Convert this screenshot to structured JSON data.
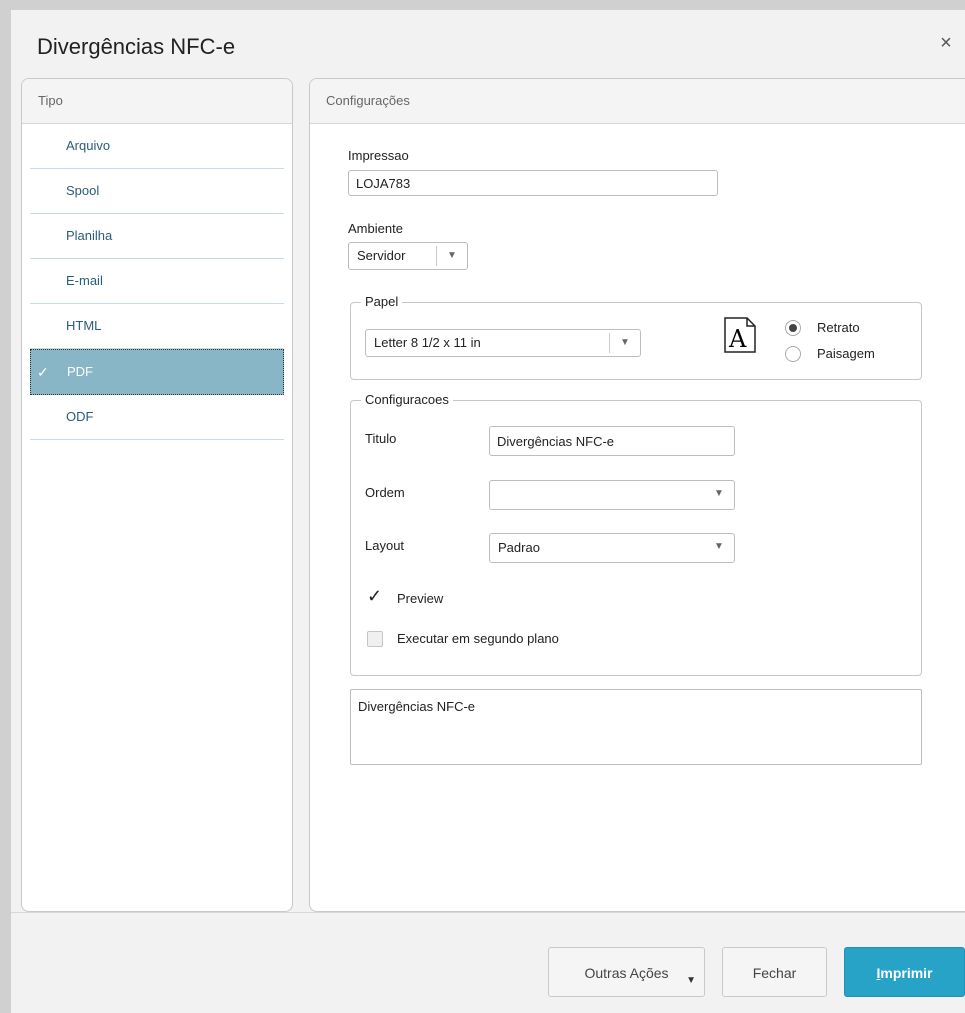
{
  "dialog": {
    "title": "Divergências NFC-e",
    "close_glyph": "×"
  },
  "tipo_panel": {
    "header": "Tipo",
    "items": [
      {
        "label": "Arquivo",
        "selected": false
      },
      {
        "label": "Spool",
        "selected": false
      },
      {
        "label": "Planilha",
        "selected": false
      },
      {
        "label": "E-mail",
        "selected": false
      },
      {
        "label": "HTML",
        "selected": false
      },
      {
        "label": "PDF",
        "selected": true
      },
      {
        "label": "ODF",
        "selected": false
      }
    ]
  },
  "config_panel": {
    "header": "Configurações",
    "impressao": {
      "label": "Impressao",
      "value": "LOJA783"
    },
    "ambiente": {
      "label": "Ambiente",
      "value": "Servidor"
    },
    "papel": {
      "legend": "Papel",
      "paper_size": "Letter 8 1/2 x 11 in",
      "icon_letter": "A",
      "orientation": {
        "retrato": "Retrato",
        "paisagem": "Paisagem",
        "selected": "Retrato"
      }
    },
    "configuracoes": {
      "legend": "Configuracoes",
      "titulo": {
        "label": "Titulo",
        "value": "Divergências NFC-e"
      },
      "ordem": {
        "label": "Ordem",
        "value": ""
      },
      "layout": {
        "label": "Layout",
        "value": "Padrao"
      },
      "preview": {
        "label": "Preview",
        "checked": true
      },
      "segundo_plano": {
        "label": "Executar em segundo plano",
        "checked": false
      }
    },
    "description_text": "Divergências NFC-e"
  },
  "footer": {
    "outras_acoes": "Outras Ações",
    "fechar": "Fechar",
    "imprimir_first": "I",
    "imprimir_rest": "mprimir"
  },
  "colors": {
    "accent": "#27a3c7",
    "selected_row": "#89b6c6",
    "link_text": "#2a5d77"
  },
  "icons": {
    "close": "close-icon",
    "check": "check-icon",
    "caret": "chevron-down-icon",
    "paper": "paper-portrait-icon"
  }
}
